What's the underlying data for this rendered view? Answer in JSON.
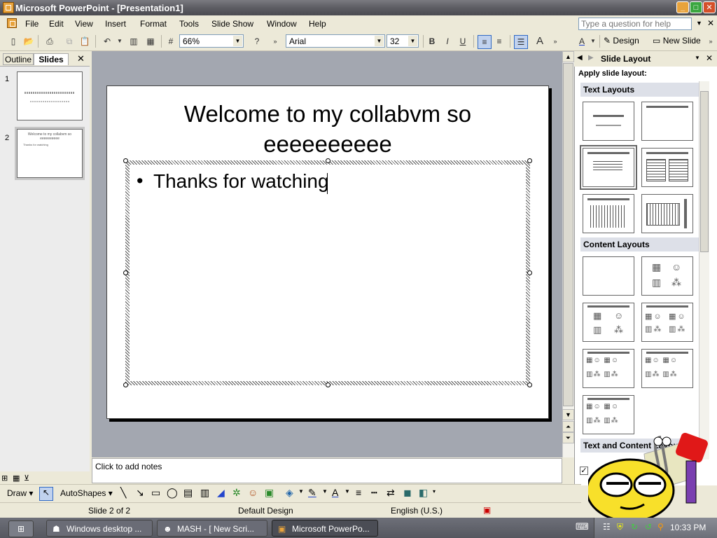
{
  "window": {
    "title": "Microsoft PowerPoint - [Presentation1]"
  },
  "menu": {
    "items": [
      "File",
      "Edit",
      "View",
      "Insert",
      "Format",
      "Tools",
      "Slide Show",
      "Window",
      "Help"
    ],
    "help_placeholder": "Type a question for help"
  },
  "toolbar": {
    "zoom": "66%",
    "font": "Arial",
    "font_size": "32",
    "design_label": "Design",
    "new_slide_label": "New Slide"
  },
  "left_pane": {
    "tabs": [
      "Outline",
      "Slides"
    ],
    "slide_numbers": [
      "1",
      "2"
    ],
    "thumb2_title": "Welcome to my collabvm so eeeeeeeeee",
    "thumb2_body": "Thanks for watching"
  },
  "slide": {
    "title_line1": "Welcome to my collabvm so",
    "title_line2": "eeeeeeeeee",
    "bullet": "•",
    "body": "Thanks for watching"
  },
  "notes": {
    "placeholder": "Click to add notes"
  },
  "task_pane": {
    "title": "Slide Layout",
    "apply_label": "Apply slide layout:",
    "sections": [
      "Text Layouts",
      "Content Layouts",
      "Text and Content Layouts"
    ]
  },
  "draw_toolbar": {
    "draw_label": "Draw",
    "autoshapes_label": "AutoShapes"
  },
  "status": {
    "slide": "Slide 2 of 2",
    "design": "Default Design",
    "language": "English (U.S.)"
  },
  "taskbar": {
    "tasks": [
      "Windows desktop ...",
      "MASH - [ New Scri...",
      "Microsoft PowerPo..."
    ],
    "clock": "10:33 PM"
  },
  "colors": {
    "title_bar": "#5d5d63",
    "slide_bg": "#ffffff",
    "edit_bg": "#a3a7b0",
    "taskbar": "#55575f"
  }
}
